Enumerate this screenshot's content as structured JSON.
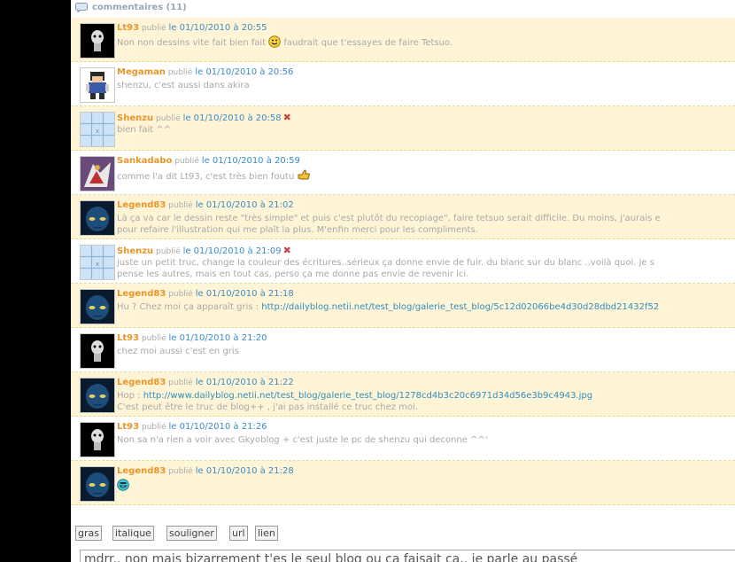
{
  "header": {
    "title": "commentaires (11)"
  },
  "labels": {
    "published": "publié"
  },
  "comments": [
    {
      "author": "Lt93",
      "date": "le 01/10/2010 à 20:55",
      "lines": [
        "Non non dessins vite fait bien fait",
        " faudrait que t'essayes de faire Tetsuo."
      ],
      "emoji": "smiley",
      "avatar": "lt93"
    },
    {
      "author": "Megaman",
      "date": "le 01/10/2010 à 20:56",
      "lines": [
        "shenzu, c'est aussi dans akira"
      ],
      "avatar": "megaman"
    },
    {
      "author": "Shenzu",
      "date": "le 01/10/2010 à 20:58",
      "lines": [
        "bien fait ^^"
      ],
      "avatar": "shenzu",
      "flag": "x"
    },
    {
      "author": "Sankadabo",
      "date": "le 01/10/2010 à 20:59",
      "lines": [
        "comme l'a dit Lt93, c'est très bien foutu"
      ],
      "emoji": "thumb",
      "avatar": "sankadabo"
    },
    {
      "author": "Legend83",
      "date": "le 01/10/2010 à 21:02",
      "lines": [
        "Là ça va car le dessin reste \"très simple\" et puis c'est plutôt du recopiage\", faire tetsuo serait difficile. Du moins, j'aurais e",
        "pour refaire l'illustration qui me plaît la plus. M'enfin merci pour les compliments."
      ],
      "avatar": "legend83"
    },
    {
      "author": "Shenzu",
      "date": "le 01/10/2010 à 21:09",
      "lines": [
        "juste un petit truc, change la couleur des écritures..sérieux ça donne envie de fuir. du blanc sur du blanc ..voilà quoi. je s",
        "pense les autres, mais en tout cas, perso ça me donne pas envie de revenir ici."
      ],
      "avatar": "shenzu",
      "flag": "x"
    },
    {
      "author": "Legend83",
      "date": "le 01/10/2010 à 21:18",
      "lines": [
        "Hu ? Chez moi ça apparaît gris : "
      ],
      "link": "http://dailyblog.netii.net/test_blog/galerie_test_blog/5c12d02066be4d30d28dbd21432f52",
      "avatar": "legend83"
    },
    {
      "author": "Lt93",
      "date": "le 01/10/2010 à 21:20",
      "lines": [
        "chez moi aussi c'est en gris"
      ],
      "avatar": "lt93"
    },
    {
      "author": "Legend83",
      "date": "le 01/10/2010 à 21:22",
      "lines": [
        "Hop : ",
        "C'est peut être le truc de blog++ , j'ai pas installé ce truc chez moi."
      ],
      "link": "http://www.dailyblog.netii.net/test_blog/galerie_test_blog/1278cd4b3c20c6971d34d56e3b9c4943.jpg",
      "avatar": "legend83"
    },
    {
      "author": "Lt93",
      "date": "le 01/10/2010 à 21:26",
      "lines": [
        "Non sa n'a rien a voir avec Gkyoblog + c'est juste le pc de shenzu qui deconne ^^'"
      ],
      "avatar": "lt93"
    },
    {
      "author": "Legend83",
      "date": "le 01/10/2010 à 21:28",
      "lines": [
        ""
      ],
      "emoji": "grin",
      "avatar": "legend83"
    }
  ],
  "toolbar": {
    "bold": "gras",
    "italic": "italique",
    "underline": "souligner",
    "url": "url",
    "link": "lien"
  },
  "textarea": {
    "value": "mdrr.. non mais bizarrement t'es le seul blog ou ca faisait ca.. je parle au passé"
  }
}
